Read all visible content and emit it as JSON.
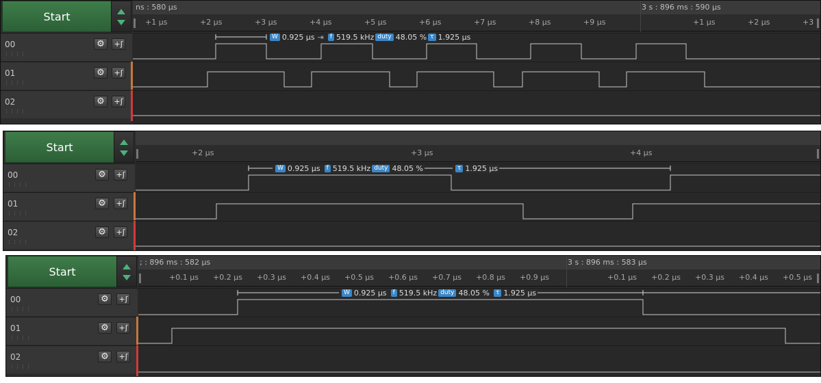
{
  "colors": {
    "green": "#2c5f36",
    "accent": "#3b86c8",
    "wave": "#c9c9c9",
    "ch01": "#c8783a",
    "ch02": "#d33a3a"
  },
  "panels": [
    {
      "start_label": "Start",
      "timestamp_left": "ns : 580 µs",
      "timestamp_right": "3 s : 896 ms : 590 µs",
      "ticks": [
        "+1 µs",
        "+2 µs",
        "+3 µs",
        "+4 µs",
        "+5 µs",
        "+6 µs",
        "+7 µs",
        "+8 µs",
        "+9 µs",
        "+1 µs",
        "+2 µs",
        "+3"
      ],
      "channels": [
        "00",
        "01",
        "02"
      ],
      "measure": {
        "w": "0.925 µs",
        "f": "519.5 kHz",
        "duty": "48.05 %",
        "t": "1.925 µs"
      },
      "icons": {
        "w": "W",
        "f": "f",
        "duty": "duty",
        "t": "τ"
      }
    },
    {
      "start_label": "Start",
      "ticks": [
        "+2 µs",
        "+3 µs",
        "+4 µs"
      ],
      "channels": [
        "00",
        "01",
        "02"
      ],
      "measure": {
        "w": "0.925 µs",
        "f": "519.5 kHz",
        "duty": "48.05 %",
        "t": "1.925 µs"
      },
      "icons": {
        "w": "W",
        "f": "f",
        "duty": "duty",
        "t": "τ"
      }
    },
    {
      "start_label": "Start",
      "timestamp_left": "; : 896 ms : 582 µs",
      "timestamp_right": "3 s : 896 ms : 583 µs",
      "ticks": [
        "+0.1 µs",
        "+0.2 µs",
        "+0.3 µs",
        "+0.4 µs",
        "+0.5 µs",
        "+0.6 µs",
        "+0.7 µs",
        "+0.8 µs",
        "+0.9 µs",
        "+0.1 µs",
        "+0.2 µs",
        "+0.3 µs",
        "+0.4 µs",
        "+0.5 µs"
      ],
      "channels": [
        "00",
        "01",
        "02"
      ],
      "measure": {
        "w": "0.925 µs",
        "f": "519.5 kHz",
        "duty": "48.05 %",
        "t": "1.925 µs"
      },
      "icons": {
        "w": "W",
        "f": "f",
        "duty": "duty",
        "t": "τ"
      }
    }
  ],
  "icons": {
    "gear": "gear-icon",
    "add_trigger": "add-trigger-icon"
  }
}
